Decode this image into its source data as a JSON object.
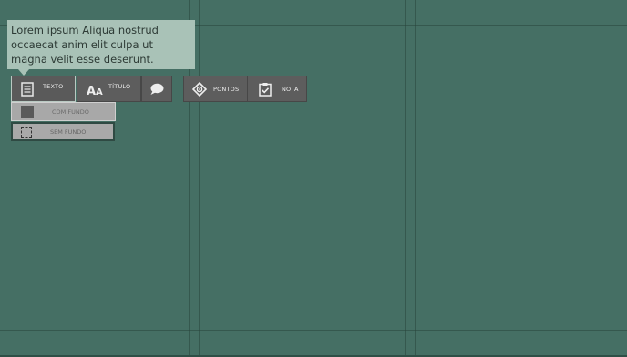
{
  "tooltip": {
    "text": "Lorem ipsum Aliqua nostrud occaecat anim elit culpa ut magna velit esse deserunt."
  },
  "toolbar": {
    "texto_label": "TEXTO",
    "titulo_label": "TÍTULO",
    "pontos_label": "PONTOS",
    "nota_label": "NOTA"
  },
  "submenu": {
    "com_fundo_label": "COM FUNDO",
    "sem_fundo_label": "SEM FUNDO"
  },
  "icons": {
    "texto": "document-lines-icon",
    "titulo": "font-size-icon",
    "comment": "speech-bubble-icon",
    "pontos": "hotspot-target-icon",
    "nota": "clipboard-check-icon",
    "com_fundo": "filled-square-icon",
    "sem_fundo": "dashed-square-icon"
  },
  "colors": {
    "canvas_background": "#456f64",
    "tooltip_background": "#a9c2b7",
    "button_background": "#5d5d5d",
    "submenu_background": "#a8a8a8"
  }
}
